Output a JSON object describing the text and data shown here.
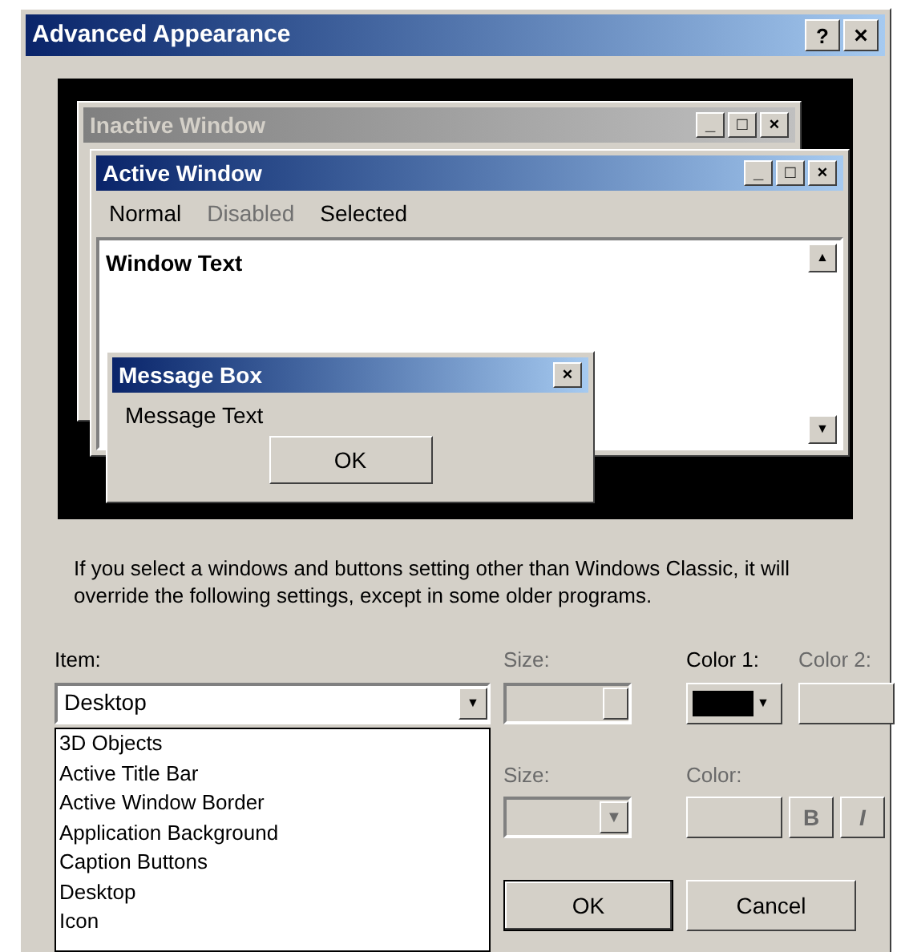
{
  "window": {
    "title": "Advanced Appearance",
    "buttons": [
      "?",
      "×"
    ]
  },
  "preview": {
    "inactive_window": {
      "title": "Inactive Window",
      "active": false,
      "buttons": [
        "_",
        "□",
        "×"
      ]
    },
    "active_window": {
      "title": "Active Window",
      "active": true,
      "buttons": [
        "_",
        "□",
        "×"
      ],
      "menu": [
        {
          "label": "Normal",
          "disabled": false
        },
        {
          "label": "Disabled",
          "disabled": true
        },
        {
          "label": "Selected",
          "disabled": false
        }
      ],
      "text": "Window Text",
      "scroll_up": "▲",
      "scroll_down": "▼"
    },
    "message_box": {
      "title": "Message Box",
      "close": "×",
      "text": "Message Text",
      "button": "OK"
    }
  },
  "note": "If you select a windows and buttons setting other than Windows Classic, it will override the following settings, except in some older programs.",
  "item": {
    "label": "Item:",
    "value": "Desktop",
    "arrow": "▼",
    "expanded": true,
    "options": [
      {
        "label": "3D Objects"
      },
      {
        "label": "Active Title Bar"
      },
      {
        "label": "Active Window Border"
      },
      {
        "label": "Application Background"
      },
      {
        "label": "Caption Buttons"
      },
      {
        "label": "Desktop"
      },
      {
        "label": "Icon"
      }
    ]
  },
  "size": {
    "label": "Size:",
    "disabled": true
  },
  "color1": {
    "label": "Color 1:",
    "disabled": false,
    "color": "#000000"
  },
  "color2": {
    "label": "Color 2:",
    "disabled": true
  },
  "font_size": {
    "label": "Size:",
    "disabled": true
  },
  "font_color": {
    "label": "Color:",
    "disabled": true
  },
  "bold": {
    "label": "B",
    "disabled": true
  },
  "italic": {
    "label": "I",
    "disabled": true
  },
  "buttons": [
    {
      "label": "OK"
    },
    {
      "label": "Cancel"
    }
  ]
}
